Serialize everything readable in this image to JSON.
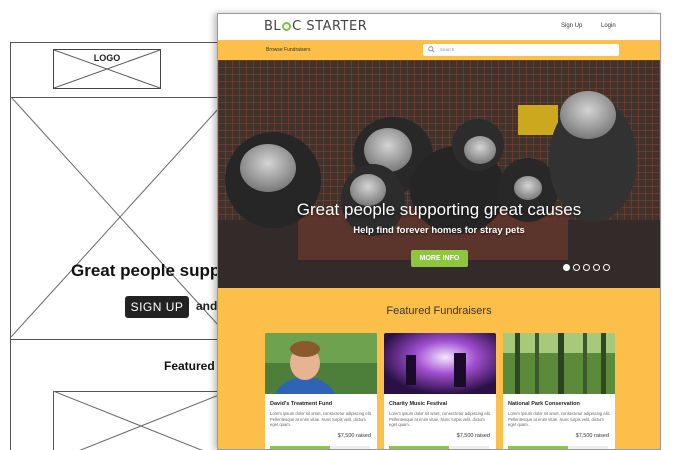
{
  "wireframe": {
    "logo": "LOGO",
    "heading": "Great people supp",
    "signup_label": "SIGN UP",
    "and_text": "and",
    "featured": "Featured"
  },
  "site": {
    "brand_b": "BL",
    "brand_c": "C STARTER",
    "signup_label": "Sign Up",
    "login_label": "Login",
    "browse_label": "Browse Fundraisers",
    "search_placeholder": "Search",
    "hero_title": "Great people supporting great causes",
    "hero_subtitle": "Help find forever homes for stray pets",
    "hero_button": "MORE INFO",
    "carousel_active_index": 0,
    "featured_title": "Featured Fundraisers",
    "cards": [
      {
        "title": "David's Treatment Fund",
        "desc": "Lorem ipsum dolor sit amet, consectetur adipiscing elit. Pellentesque at enim vitae. Nunc turpis velit, dictum eget quam.",
        "raised": "$7,500 raised",
        "progress": 0.6
      },
      {
        "title": "Charity Music Festival",
        "desc": "Lorem ipsum dolor sit amet, consectetur adipiscing elit. Pellentesque at enim vitae. Nunc turpis velit, dictum eget quam.",
        "raised": "$7,500 raised",
        "progress": 0.6
      },
      {
        "title": "National Park Conservation",
        "desc": "Lorem ipsum dolor sit amet, consectetur adipiscing elit. Pellentesque at enim vitae. Nunc turpis velit, dictum eget quam.",
        "raised": "$7,500 raised",
        "progress": 0.6
      }
    ]
  },
  "colors": {
    "accent_yellow": "#fcc04a",
    "accent_green": "#8dc63f"
  }
}
